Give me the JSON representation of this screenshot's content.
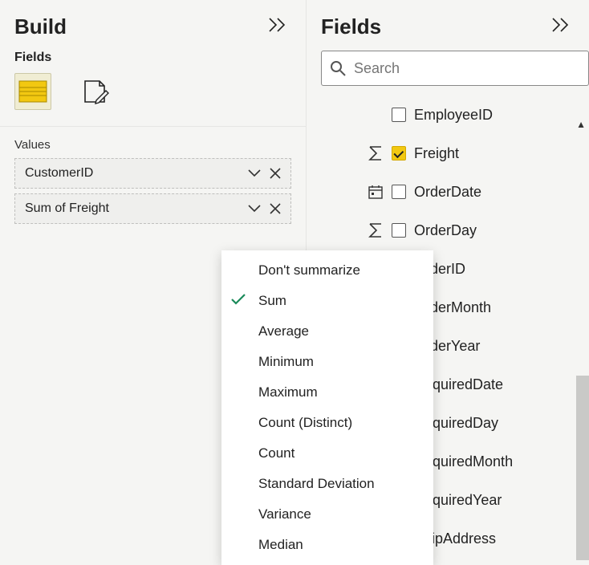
{
  "left": {
    "title": "Build",
    "fields_label": "Fields",
    "values_label": "Values",
    "tools": [
      "table-visual",
      "edit-visual"
    ],
    "selected_tool": 0,
    "value_pills": [
      {
        "label": "CustomerID"
      },
      {
        "label": "Sum of Freight"
      }
    ]
  },
  "right": {
    "title": "Fields",
    "search_placeholder": "Search",
    "fields": [
      {
        "name": "EmployeeID",
        "checked": false,
        "indicator": null
      },
      {
        "name": "Freight",
        "checked": true,
        "indicator": "sigma"
      },
      {
        "name": "OrderDate",
        "checked": false,
        "indicator": "calendar"
      },
      {
        "name": "OrderDay",
        "checked": false,
        "indicator": "sigma"
      },
      {
        "name": "OrderID",
        "checked": false,
        "indicator": null
      },
      {
        "name": "OrderMonth",
        "checked": false,
        "indicator": null
      },
      {
        "name": "OrderYear",
        "checked": false,
        "indicator": null
      },
      {
        "name": "RequiredDate",
        "checked": false,
        "indicator": null
      },
      {
        "name": "RequiredDay",
        "checked": false,
        "indicator": null
      },
      {
        "name": "RequiredMonth",
        "checked": false,
        "indicator": null
      },
      {
        "name": "RequiredYear",
        "checked": false,
        "indicator": null
      },
      {
        "name": "ShipAddress",
        "checked": false,
        "indicator": null
      }
    ]
  },
  "context_menu": {
    "selected": "Sum",
    "items": [
      "Don't summarize",
      "Sum",
      "Average",
      "Minimum",
      "Maximum",
      "Count (Distinct)",
      "Count",
      "Standard Deviation",
      "Variance",
      "Median"
    ]
  }
}
